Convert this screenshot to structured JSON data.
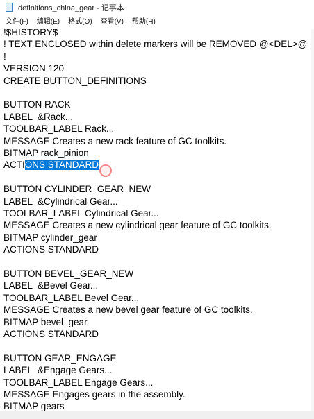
{
  "window": {
    "title": "definitions_china_gear - 记事本"
  },
  "menu": [
    {
      "label": "文件(F)"
    },
    {
      "label": "编辑(E)"
    },
    {
      "label": "格式(O)"
    },
    {
      "label": "查看(V)"
    },
    {
      "label": "帮助(H)"
    }
  ],
  "lines": [
    "!$HISTORY$",
    "! TEXT ENCLOSED within delete markers will be REMOVED @<DEL>@",
    "!",
    "VERSION 120",
    "CREATE BUTTON_DEFINITIONS",
    "",
    "BUTTON RACK",
    "LABEL  &Rack...",
    "TOOLBAR_LABEL Rack...",
    "MESSAGE Creates a new rack feature of GC toolkits.",
    "BITMAP rack_pinion",
    "ACTIONS STANDARD",
    "",
    "BUTTON CYLINDER_GEAR_NEW",
    "LABEL  &Cylindrical Gear...",
    "TOOLBAR_LABEL Cylindrical Gear...",
    "MESSAGE Creates a new cylindrical gear feature of GC toolkits.",
    "BITMAP cylinder_gear",
    "ACTIONS STANDARD",
    "",
    "BUTTON BEVEL_GEAR_NEW",
    "LABEL  &Bevel Gear...",
    "TOOLBAR_LABEL Bevel Gear...",
    "MESSAGE Creates a new bevel gear feature of GC toolkits.",
    "BITMAP bevel_gear",
    "ACTIONS STANDARD",
    "",
    "BUTTON GEAR_ENGAGE",
    "LABEL  &Engage Gears...",
    "TOOLBAR_LABEL Engage Gears...",
    "MESSAGE Engages gears in the assembly.",
    "BITMAP gears"
  ],
  "selection": {
    "line_index": 11,
    "before": "ACTI",
    "selected": "ONS STANDARD"
  }
}
